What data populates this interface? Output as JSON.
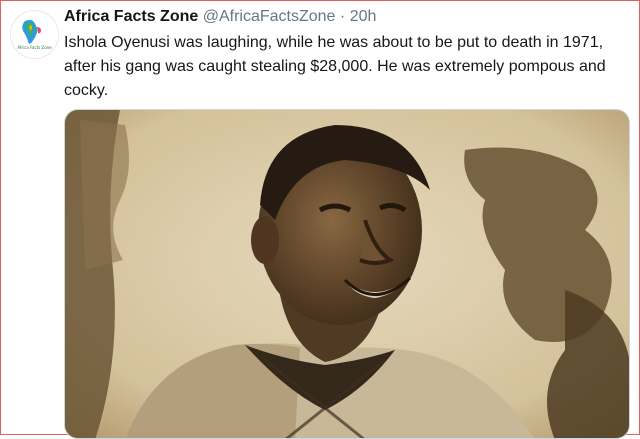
{
  "tweet": {
    "author_name": "Africa Facts Zone",
    "handle": "@AfricaFactsZone",
    "separator": "·",
    "time": "20h",
    "text": "Ishola Oyenusi was laughing, while he was about to be put to death in 1971, after his gang was caught stealing $28,000. He was extremely pompous and cocky.",
    "avatar_logo_text": "Africa Facts Zone",
    "media_description_icon": "photo-icon"
  },
  "colors": {
    "name": "#14171a",
    "secondary": "#657786",
    "frame_border": "#e06060",
    "sepia_light": "#e6d9bb",
    "sepia_dark": "#2a2014"
  }
}
